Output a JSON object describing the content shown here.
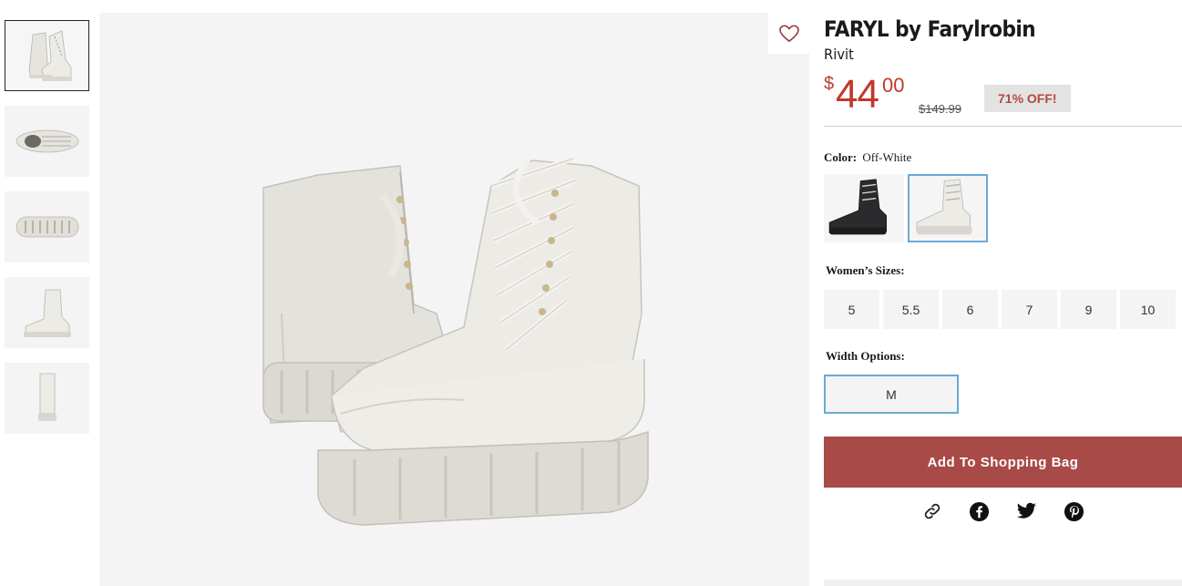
{
  "product": {
    "brand": "FARYL by Farylrobin",
    "model": "Rivit",
    "price": {
      "currency": "$",
      "dollars": "44",
      "cents": "00",
      "original": "$149.99",
      "discount": "71% OFF!"
    }
  },
  "color": {
    "label": "Color:",
    "value": "Off-White",
    "swatches": [
      "Black",
      "Off-White"
    ]
  },
  "sizes": {
    "label": "Women’s Sizes:",
    "options": [
      "5",
      "5.5",
      "6",
      "7",
      "9",
      "10"
    ]
  },
  "width": {
    "label": "Width Options:",
    "options": [
      "M"
    ]
  },
  "cta": {
    "add_to_bag": "Add To Shopping Bag"
  },
  "icons": {
    "wishlist": "heart-icon",
    "share": [
      "link-icon",
      "facebook-icon",
      "twitter-icon",
      "pinterest-icon"
    ]
  },
  "colors": {
    "price": "#c0392b",
    "cta": "#a84a47",
    "selected_border": "#6aaad6"
  }
}
